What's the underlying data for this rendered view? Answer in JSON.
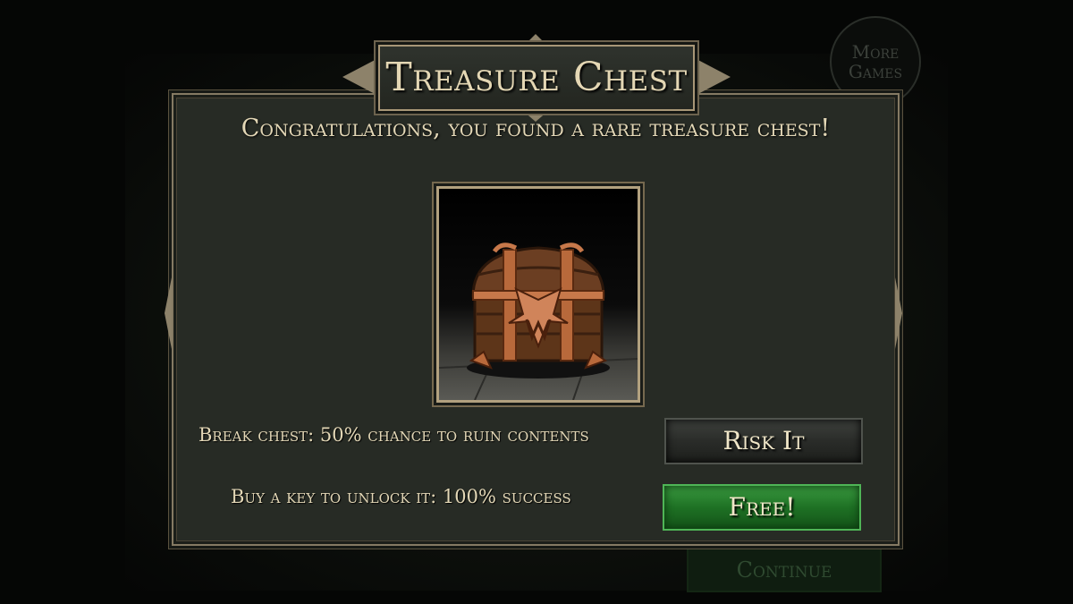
{
  "dialog": {
    "title": "Treasure Chest",
    "message": "Congratulations, you found a rare treasure chest!",
    "break_option": {
      "description": "Break chest: 50% chance to ruin contents",
      "button_label": "Risk It"
    },
    "key_option": {
      "description": "Buy a key to unlock it: 100% success",
      "button_label": "Free!"
    }
  },
  "background": {
    "more_games_label": "More Games",
    "continue_label": "Continue"
  },
  "colors": {
    "panel": "#272b25",
    "frame_gold": "#a89777",
    "text_cream": "#e3d7b6",
    "free_green": "#1e7124",
    "risk_gray": "#2a2c29"
  },
  "icons": {
    "chest": "treasure-chest-icon"
  }
}
